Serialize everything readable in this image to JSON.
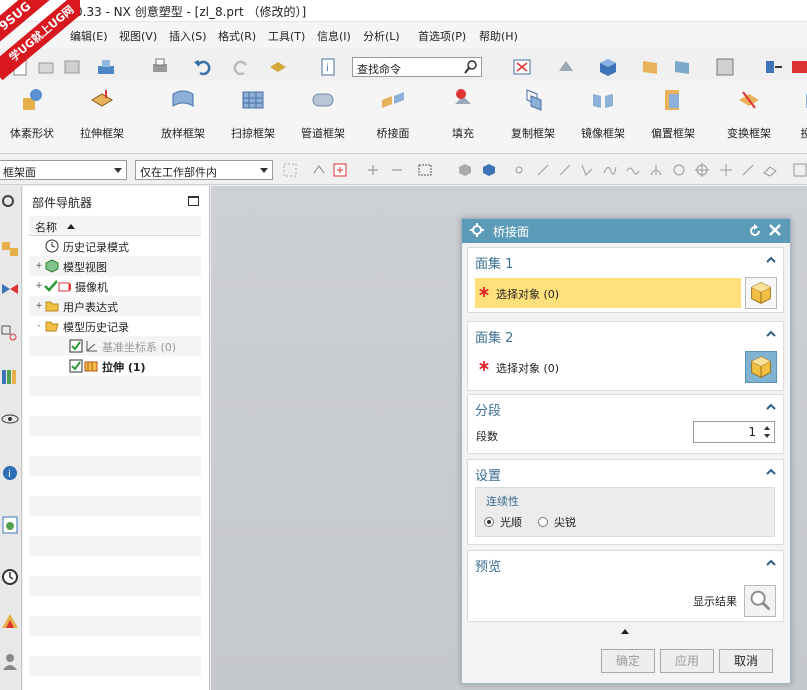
{
  "window": {
    "title": "0.33 - NX 创意塑型 - [zl_8.prt （修改的）]"
  },
  "logo": {
    "line1": "9SUG",
    "line2": "学UG就上UG网"
  },
  "menu": [
    "编辑(E)",
    "视图(V)",
    "插入(S)",
    "格式(R)",
    "工具(T)",
    "信息(I)",
    "分析(L)",
    "首选项(P)",
    "帮助(H)"
  ],
  "search": {
    "placeholder": "查找命令"
  },
  "ribbon": [
    "体素形状",
    "拉伸框架",
    "放样框架",
    "扫掠框架",
    "管道框架",
    "桥接面",
    "填充",
    "复制框架",
    "镜像框架",
    "偏置框架",
    "变换框架",
    "投"
  ],
  "selection_bar": {
    "filter": "框架面",
    "scope": "仅在工作部件内"
  },
  "navigator": {
    "title": "部件导航器",
    "column": "名称",
    "items": [
      {
        "label": "历史记录模式",
        "icon": "clock-icon",
        "expander": ""
      },
      {
        "label": "模型视图",
        "icon": "model-views-icon",
        "expander": "+"
      },
      {
        "label": "摄像机",
        "icon": "camera-icon",
        "expander": "+"
      },
      {
        "label": "用户表达式",
        "icon": "folder-icon",
        "expander": "+"
      },
      {
        "label": "模型历史记录",
        "icon": "folder-open-icon",
        "expander": "-"
      },
      {
        "label": "基准坐标系 (0)",
        "icon": "datum-csys-icon",
        "expander": ""
      },
      {
        "label": "拉伸 (1)",
        "icon": "extrude-icon",
        "expander": ""
      }
    ]
  },
  "dialog": {
    "title": "桥接面",
    "face_set_1": {
      "title": "面集 1",
      "select": "选择对象 (0)"
    },
    "face_set_2": {
      "title": "面集 2",
      "select": "选择对象 (0)"
    },
    "segments": {
      "title": "分段",
      "label": "段数",
      "value": "1"
    },
    "settings": {
      "title": "设置",
      "continuity": "连续性",
      "opt_smooth": "光顺",
      "opt_sharp": "尖锐",
      "selected": "光顺"
    },
    "preview": {
      "title": "预览",
      "show_result": "显示结果"
    },
    "buttons": {
      "ok": "确定",
      "apply": "应用",
      "cancel": "取消"
    }
  },
  "colors": {
    "dialog_header": "#5b9bb7",
    "group_title": "#3b6e91",
    "active_select": "#ffe07a",
    "required_mark": "#e0262b"
  }
}
